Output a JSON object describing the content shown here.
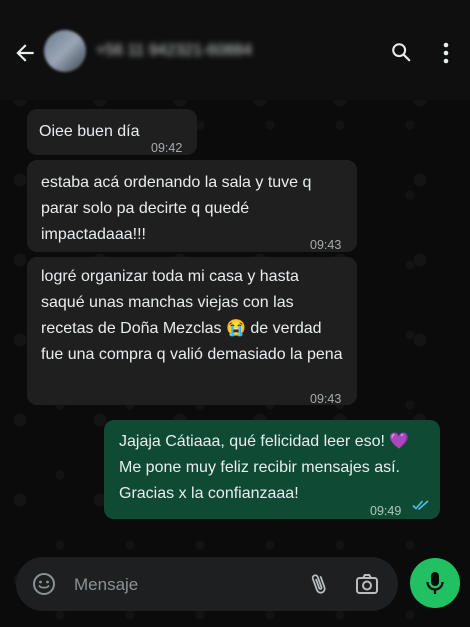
{
  "header": {
    "contact_name": "+56 11 942321-60884"
  },
  "messages": [
    {
      "text": "Oiee buen día",
      "time": "09:42"
    },
    {
      "text": "estaba acá ordenando la sala y tuve q parar solo pa decirte q quedé impactadaaa!!!",
      "time": "09:43"
    },
    {
      "text": "logré organizar toda mi casa y hasta saqué unas manchas viejas con las recetas de Doña Mezclas 😭 de verdad fue una compra q valió demasiado la pena",
      "time": "09:43"
    },
    {
      "text": "Jajaja Cátiaaa, qué felicidad leer eso! 💜 Me pone muy feliz recibir mensajes así. Gracias x la confianzaaa!",
      "time": "09:49",
      "status": "read"
    }
  ],
  "composer": {
    "placeholder": "Mensaje"
  },
  "colors": {
    "incoming_bubble": "#1f1f1f",
    "outgoing_bubble": "#0f4a35",
    "accent": "#21c063",
    "read_ticks": "#53bdeb"
  },
  "icons": [
    "back-arrow-icon",
    "search-icon",
    "more-vertical-icon",
    "emoji-icon",
    "attach-icon",
    "camera-icon",
    "mic-icon",
    "double-check-icon"
  ]
}
